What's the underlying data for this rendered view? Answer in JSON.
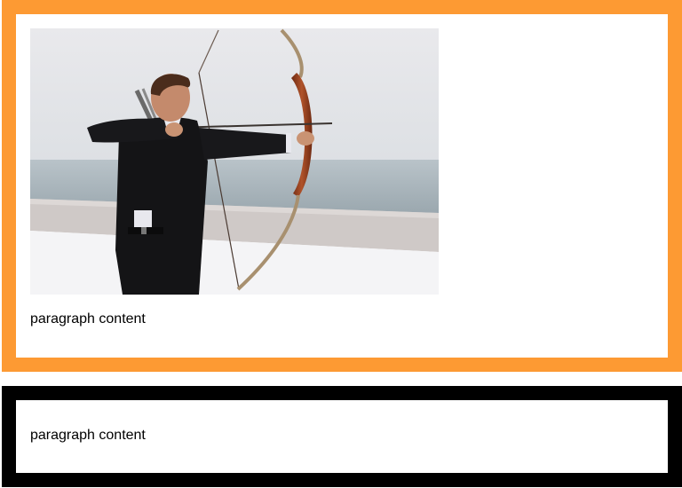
{
  "colors": {
    "orange_border": "#fd9a33",
    "black_border": "#000000"
  },
  "card_image": {
    "icon": "archer-photo",
    "alt": ""
  },
  "card_image_text": "paragraph content",
  "card_plain_text": "paragraph content"
}
